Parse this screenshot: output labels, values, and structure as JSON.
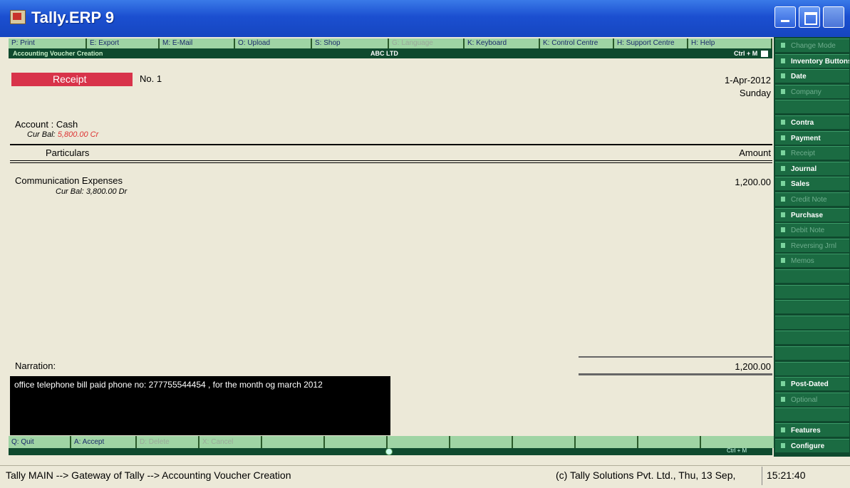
{
  "window": {
    "title": "Tally.ERP 9"
  },
  "top_buttons": [
    {
      "label": "P: Print",
      "w": 110,
      "enabled": true
    },
    {
      "label": "E: Export",
      "w": 102,
      "enabled": true
    },
    {
      "label": "M: E-Mail",
      "w": 106,
      "enabled": true
    },
    {
      "label": "O: Upload",
      "w": 108,
      "enabled": true
    },
    {
      "label": "S: Shop",
      "w": 108,
      "enabled": true
    },
    {
      "label": "G: Language",
      "w": 106,
      "enabled": false
    },
    {
      "label": "K: Keyboard",
      "w": 106,
      "enabled": true
    },
    {
      "label": "K: Control Centre",
      "w": 104,
      "enabled": true
    },
    {
      "label": "H: Support Centre",
      "w": 104,
      "enabled": true
    },
    {
      "label": "H: Help",
      "w": 118,
      "enabled": true
    }
  ],
  "header": {
    "screen_name": "Accounting Voucher Creation",
    "company": "ABC LTD",
    "shortcut": "Ctrl + M"
  },
  "voucher": {
    "type": "Receipt",
    "number_label": "No. 1",
    "date": "1-Apr-2012",
    "day": "Sunday",
    "account_label": "Account :",
    "account_name": "Cash",
    "account_bal_label": "Cur Bal:",
    "account_bal_value": "5,800.00 Cr",
    "col_particulars": "Particulars",
    "col_amount": "Amount",
    "ledger_name": "Communication Expenses",
    "ledger_bal_label": "Cur Bal:",
    "ledger_bal_value": "3,800.00 Dr",
    "ledger_amount": "1,200.00",
    "narration_label": "Narration:",
    "total": "1,200.00",
    "narration_text": "office telephone bill paid phone no: 277755544454 , for the month og march 2012"
  },
  "bottom_buttons": [
    {
      "label": "Q: Quit",
      "w": 88,
      "enabled": true
    },
    {
      "label": "A: Accept",
      "w": 92,
      "enabled": true
    },
    {
      "label": "D: Delete",
      "w": 88,
      "enabled": false
    },
    {
      "label": "X: Cancel",
      "w": 88,
      "enabled": false
    },
    {
      "label": "",
      "w": 88,
      "enabled": true
    },
    {
      "label": "",
      "w": 88,
      "enabled": true
    },
    {
      "label": "",
      "w": 88,
      "enabled": true
    },
    {
      "label": "",
      "w": 88,
      "enabled": true
    },
    {
      "label": "",
      "w": 88,
      "enabled": true
    },
    {
      "label": "",
      "w": 88,
      "enabled": true
    },
    {
      "label": "",
      "w": 88,
      "enabled": true
    },
    {
      "label": "",
      "w": 104,
      "enabled": true
    }
  ],
  "bottom_strip": {
    "shortcut": "Ctrl + M"
  },
  "right_panel": [
    {
      "label": "Change Mode",
      "enabled": false
    },
    {
      "label": "Inventory Buttons",
      "enabled": true
    },
    {
      "label": "Date",
      "enabled": true
    },
    {
      "label": "Company",
      "enabled": false
    },
    {
      "label": "",
      "enabled": true
    },
    {
      "label": "Contra",
      "enabled": true
    },
    {
      "label": "Payment",
      "enabled": true
    },
    {
      "label": "Receipt",
      "enabled": false
    },
    {
      "label": "Journal",
      "enabled": true
    },
    {
      "label": "Sales",
      "enabled": true
    },
    {
      "label": "Credit Note",
      "enabled": false
    },
    {
      "label": "Purchase",
      "enabled": true
    },
    {
      "label": "Debit Note",
      "enabled": false
    },
    {
      "label": "Reversing Jrnl",
      "enabled": false
    },
    {
      "label": "Memos",
      "enabled": false
    },
    {
      "label": "",
      "enabled": true
    },
    {
      "label": "",
      "enabled": true
    },
    {
      "label": "",
      "enabled": true
    },
    {
      "label": "",
      "enabled": true
    },
    {
      "label": "",
      "enabled": true
    },
    {
      "label": "",
      "enabled": true
    },
    {
      "label": "",
      "enabled": true
    },
    {
      "label": "Post-Dated",
      "enabled": true
    },
    {
      "label": "Optional",
      "enabled": false
    },
    {
      "label": "",
      "enabled": true
    },
    {
      "label": "Features",
      "enabled": true
    },
    {
      "label": "Configure",
      "enabled": true
    }
  ],
  "status": {
    "path": "Tally MAIN --> Gateway of Tally --> Accounting Voucher  Creation",
    "copyright": "(c) Tally Solutions Pvt. Ltd., Thu, 13 Sep,",
    "time": "15:21:40"
  }
}
